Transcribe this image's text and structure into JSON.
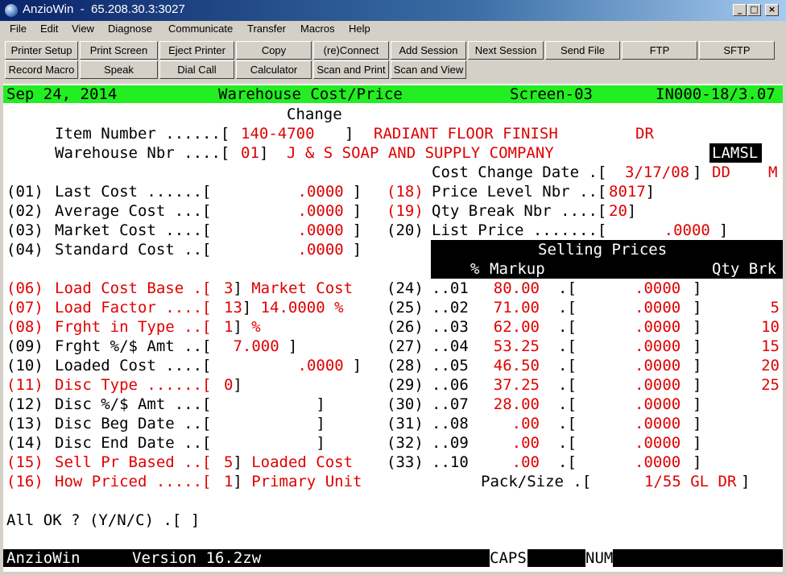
{
  "window": {
    "title": "AnzioWin  -  65.208.30.3:3027",
    "buttons": {
      "minimize": "_",
      "maximize": "□",
      "close": "×"
    }
  },
  "menu": [
    "File",
    "Edit",
    "View",
    "Diagnose",
    "Communicate",
    "Transfer",
    "Macros",
    "Help"
  ],
  "toolbar": {
    "row1": [
      "Printer Setup",
      "Print Screen",
      "Eject Printer",
      "Copy",
      "(re)Connect",
      "Add Session",
      "Next Session",
      "Send File",
      "FTP",
      "SFTP"
    ],
    "row2": [
      "Record Macro",
      "Speak",
      "Dial Call",
      "Calculator",
      "Scan and Print",
      "Scan and View"
    ]
  },
  "terminal": {
    "header": {
      "date": "Sep 24, 2014",
      "title": "Warehouse Cost/Price",
      "screen": "Screen-03",
      "code": "IN000-18/3.07"
    },
    "mode": "Change",
    "item_label": "Item Number ......[",
    "item_number": "140-4700",
    "item_close": "]",
    "item_desc": "RADIANT FLOOR FINISH",
    "item_code": "DR",
    "wh_label": "Warehouse Nbr ....[",
    "wh_number": "01",
    "wh_close": "]",
    "wh_name": "J & S SOAP AND SUPPLY COMPANY",
    "user_badge": "LAMSL",
    "ccd_label": "Cost Change Date .[",
    "ccd_value": "3/17/08",
    "ccd_close": "]",
    "ccd_dd": "DD",
    "ccd_m": "M",
    "left_fields": [
      {
        "num": "(01)",
        "label": "Last Cost ......[",
        "value": "        .0000",
        "close": " ]",
        "red": false
      },
      {
        "num": "(02)",
        "label": "Average Cost ...[",
        "value": "        .0000",
        "close": " ]",
        "red": false
      },
      {
        "num": "(03)",
        "label": "Market Cost ....[",
        "value": "        .0000",
        "close": " ]",
        "red": false
      },
      {
        "num": "(04)",
        "label": "Standard Cost ..[",
        "value": "        .0000",
        "close": " ]",
        "red": false
      },
      {
        "num": "(06)",
        "label": "Load Cost Base .[",
        "value": "3",
        "close": "]",
        "extra": "Market Cost",
        "red": true
      },
      {
        "num": "(07)",
        "label": "Load Factor ....[",
        "value": "13",
        "close": "]",
        "extra": "14.0000 %",
        "red": true
      },
      {
        "num": "(08)",
        "label": "Frght in Type ..[",
        "value": "1",
        "close": "]",
        "extra": "%",
        "red": true
      },
      {
        "num": "(09)",
        "label": "Frght %/$ Amt ..[",
        "value": " 7.000",
        "close": " ]",
        "red": false
      },
      {
        "num": "(10)",
        "label": "Loaded Cost ....[",
        "value": "        .0000",
        "close": " ]",
        "red": false
      },
      {
        "num": "(11)",
        "label": "Disc Type ......[",
        "value": "0",
        "close": "]",
        "red": true
      },
      {
        "num": "(12)",
        "label": "Disc %/$ Amt ...[",
        "value": "",
        "close": "          ]",
        "red": false
      },
      {
        "num": "(13)",
        "label": "Disc Beg Date ..[",
        "value": "",
        "close": "          ]",
        "red": false
      },
      {
        "num": "(14)",
        "label": "Disc End Date ..[",
        "value": "",
        "close": "          ]",
        "red": false
      },
      {
        "num": "(15)",
        "label": "Sell Pr Based ..[",
        "value": "5",
        "close": "]",
        "extra": "Loaded Cost",
        "red": true
      },
      {
        "num": "(16)",
        "label": "How Priced .....[",
        "value": "1",
        "close": "]",
        "extra": "Primary Unit",
        "red": true
      }
    ],
    "right_fields": [
      {
        "num": "(18)",
        "label": "Price Level Nbr ..[",
        "value": "8017",
        "close": "]",
        "red": true
      },
      {
        "num": "(19)",
        "label": "Qty Break Nbr ....[",
        "value": "20",
        "close": "]",
        "red": true
      },
      {
        "num": "(20)",
        "label": "List Price .......[",
        "value": "      .0000",
        "close": " ]",
        "red": false
      }
    ],
    "selling_title": "Selling Prices",
    "col_pct": "%",
    "col_markup": "Markup",
    "col_qty": "Qty Brk",
    "price_rows": [
      {
        "num": "(24)",
        "lvl": "..01",
        "markup": "80.00",
        "price": ".0000",
        "qty": ""
      },
      {
        "num": "(25)",
        "lvl": "..02",
        "markup": "71.00",
        "price": ".0000",
        "qty": "5"
      },
      {
        "num": "(26)",
        "lvl": "..03",
        "markup": "62.00",
        "price": ".0000",
        "qty": "10"
      },
      {
        "num": "(27)",
        "lvl": "..04",
        "markup": "53.25",
        "price": ".0000",
        "qty": "15"
      },
      {
        "num": "(28)",
        "lvl": "..05",
        "markup": "46.50",
        "price": ".0000",
        "qty": "20"
      },
      {
        "num": "(29)",
        "lvl": "..06",
        "markup": "37.25",
        "price": ".0000",
        "qty": "25"
      },
      {
        "num": "(30)",
        "lvl": "..07",
        "markup": "28.00",
        "price": ".0000",
        "qty": ""
      },
      {
        "num": "(31)",
        "lvl": "..08",
        "markup": ".00",
        "price": ".0000",
        "qty": ""
      },
      {
        "num": "(32)",
        "lvl": "..09",
        "markup": ".00",
        "price": ".0000",
        "qty": ""
      },
      {
        "num": "(33)",
        "lvl": "..10",
        "markup": ".00",
        "price": ".0000",
        "qty": ""
      }
    ],
    "pack_label": "Pack/Size .[",
    "pack_value": "1/55 GL DR",
    "pack_close": "]",
    "prompt": "All OK ? (Y/N/C) .[ ]"
  },
  "statusbar": {
    "app": "AnzioWin",
    "version": "Version 16.2zw",
    "caps": "CAPS",
    "num": "NUM"
  }
}
